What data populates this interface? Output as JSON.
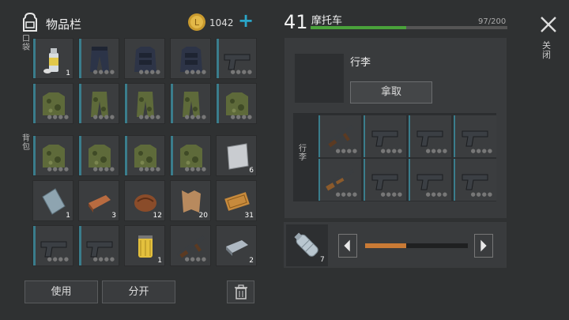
{
  "header": {
    "title": "物品栏",
    "coins": "1042",
    "add_icon": "plus-icon"
  },
  "labels": {
    "pockets": "口袋",
    "backpack": "背包"
  },
  "pockets": [
    {
      "item": "spray-can-icon",
      "count": "1"
    },
    {
      "item": "armor-pants-icon",
      "count": ""
    },
    {
      "item": "armor-vest-icon",
      "count": ""
    },
    {
      "item": "armor-vest-icon",
      "count": ""
    },
    {
      "item": "pistol-icon",
      "count": ""
    },
    {
      "item": "camo-jacket-icon",
      "count": ""
    },
    {
      "item": "camo-pants-icon",
      "count": ""
    },
    {
      "item": "camo-pants-icon",
      "count": ""
    },
    {
      "item": "camo-pants-icon",
      "count": ""
    },
    {
      "item": "camo-jacket-icon",
      "count": ""
    }
  ],
  "backpack": [
    {
      "item": "camo-jacket-icon",
      "count": ""
    },
    {
      "item": "camo-jacket-icon",
      "count": ""
    },
    {
      "item": "camo-jacket-icon",
      "count": ""
    },
    {
      "item": "camo-jacket-icon",
      "count": ""
    },
    {
      "item": "metal-sheet-icon",
      "count": "6"
    },
    {
      "item": "glass-plate-icon",
      "count": "1"
    },
    {
      "item": "copper-ingot-icon",
      "count": "3"
    },
    {
      "item": "walnut-icon",
      "count": "12"
    },
    {
      "item": "leather-icon",
      "count": "20"
    },
    {
      "item": "ticket-icon",
      "count": "31"
    },
    {
      "item": "pistol-icon",
      "count": ""
    },
    {
      "item": "pistol-icon",
      "count": ""
    },
    {
      "item": "oil-filter-icon",
      "count": "1"
    },
    {
      "item": "assault-rifle-icon",
      "count": ""
    },
    {
      "item": "steel-ingot-icon",
      "count": "2"
    }
  ],
  "buttons": {
    "use": "使用",
    "split": "分开",
    "delete_icon": "trash-icon"
  },
  "vehicle": {
    "level": "41",
    "name": "摩托车",
    "capacity": "97/200",
    "fill_fraction": 0.485
  },
  "luggage": {
    "title": "行李",
    "take": "拿取",
    "label": "行李",
    "items": [
      {
        "item": "assault-rifle-icon"
      },
      {
        "item": "pistol-icon"
      },
      {
        "item": "pistol-icon"
      },
      {
        "item": "pistol-icon"
      },
      {
        "item": "shotgun-icon"
      },
      {
        "item": "pistol-icon"
      },
      {
        "item": "pistol-icon"
      },
      {
        "item": "pistol-icon"
      }
    ]
  },
  "fuel": {
    "item": "water-bottle-icon",
    "count": "7",
    "slider_fraction": 0.4
  },
  "close": {
    "label": "关闭"
  },
  "colors": {
    "bar": "#3a7d8c",
    "progress": "#4aa23b",
    "slider": "#c97a35",
    "coin": "#c99a2e"
  }
}
